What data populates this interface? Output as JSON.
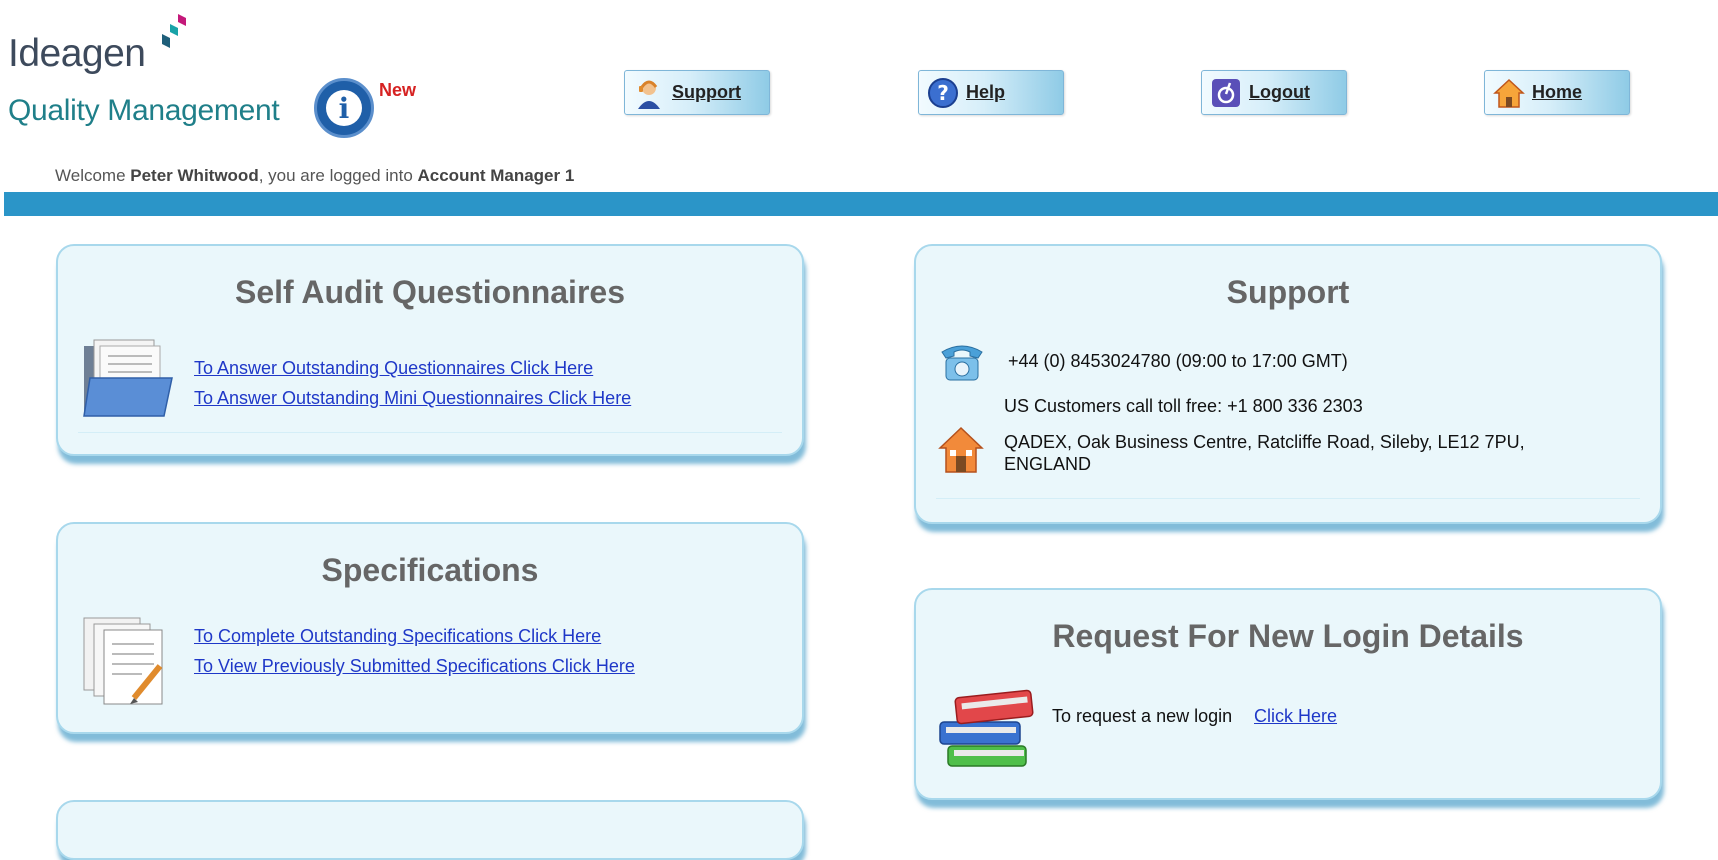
{
  "header": {
    "brand": "Ideagen",
    "product": "Quality Management",
    "new_badge": "New",
    "nav": [
      {
        "label": "Support",
        "icon": "support-agent-icon"
      },
      {
        "label": "Help",
        "icon": "help-icon"
      },
      {
        "label": "Logout",
        "icon": "logout-icon"
      },
      {
        "label": "Home",
        "icon": "home-icon"
      }
    ]
  },
  "welcome": {
    "prefix": "Welcome ",
    "user": "Peter Whitwood",
    "middle": ", you are logged into ",
    "account": "Account Manager 1"
  },
  "panels": {
    "self_audit": {
      "title": "Self Audit Questionnaires",
      "links": [
        "To Answer Outstanding Questionnaires Click Here",
        "To Answer Outstanding Mini Questionnaires Click Here"
      ]
    },
    "specifications": {
      "title": "Specifications",
      "links": [
        "To Complete Outstanding Specifications Click Here",
        "To View Previously Submitted Specifications Click Here"
      ]
    },
    "support": {
      "title": "Support",
      "phone": "+44   (0)   8453024780   (09:00 to 17:00 GMT)",
      "us_line": "US Customers call toll free: +1 800 336 2303",
      "address_line1": "QADEX, Oak Business Centre,  Ratcliffe Road,  Sileby,  LE12 7PU,",
      "address_line2": "ENGLAND"
    },
    "login": {
      "title": "Request For New Login Details",
      "text": "To request a new login",
      "link": "Click Here"
    }
  },
  "colors": {
    "accent_bar": "#2b95c8",
    "panel_bg": "#eaf7fb",
    "link": "#1f38c8",
    "new_badge": "#d62222"
  }
}
